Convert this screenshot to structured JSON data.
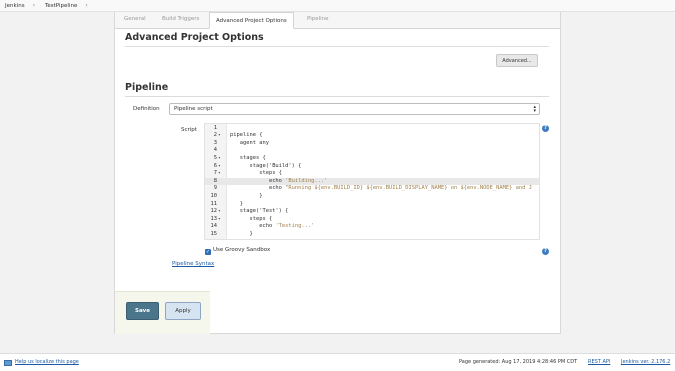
{
  "breadcrumb": {
    "items": [
      "Jenkins",
      "TestPipeline"
    ],
    "separator": "›"
  },
  "tabs": [
    "General",
    "Build Triggers",
    "Advanced Project Options",
    "Pipeline"
  ],
  "advanced_section": {
    "title": "Advanced Project Options",
    "button_label": "Advanced..."
  },
  "pipeline_section": {
    "title": "Pipeline",
    "definition_label": "Definition",
    "definition_value": "Pipeline script",
    "script_label": "Script",
    "sandbox_label": "Use Groovy Sandbox",
    "syntax_link": "Pipeline Syntax"
  },
  "script_lines": [
    {
      "n": "1",
      "fold": "",
      "code": ""
    },
    {
      "n": "2",
      "fold": "▾",
      "code": "pipeline {"
    },
    {
      "n": "3",
      "fold": "",
      "code": "   agent any"
    },
    {
      "n": "4",
      "fold": "",
      "code": ""
    },
    {
      "n": "5",
      "fold": "▾",
      "code": "   stages {"
    },
    {
      "n": "6",
      "fold": "▾",
      "code": "      stage('Build') {"
    },
    {
      "n": "7",
      "fold": "▾",
      "code": "         steps {"
    },
    {
      "n": "8",
      "fold": "",
      "code": "            echo 'Building...'"
    },
    {
      "n": "9",
      "fold": "",
      "code": "            echo \"Running ${env.BUILD_ID} ${env.BUILD_DISPLAY_NAME} on ${env.NODE_NAME} and J"
    },
    {
      "n": "10",
      "fold": "",
      "code": "         }"
    },
    {
      "n": "11",
      "fold": "",
      "code": "   }"
    },
    {
      "n": "12",
      "fold": "▾",
      "code": "   stage('Test') {"
    },
    {
      "n": "13",
      "fold": "▾",
      "code": "      steps {"
    },
    {
      "n": "14",
      "fold": "",
      "code": "         echo 'Testing...'"
    },
    {
      "n": "15",
      "fold": "",
      "code": "      }"
    }
  ],
  "highlighted_line": "8",
  "buttons": {
    "save": "Save",
    "apply": "Apply"
  },
  "footer": {
    "localize_link": "Help us localize this page",
    "generated": "Page generated: Aug 17, 2019 4:28:46 PM CDT",
    "rest_api": "REST API",
    "version": "Jenkins ver. 2.176.2"
  },
  "colors": {
    "save_button": "#4b758b",
    "apply_button": "#d6e4f2",
    "link": "#1b5aa3",
    "help_icon": "#3d7dbf"
  },
  "icons": {
    "help": "help-icon",
    "checkbox": "checkbox-checked-icon",
    "select_arrow": "updown-arrow-icon"
  }
}
